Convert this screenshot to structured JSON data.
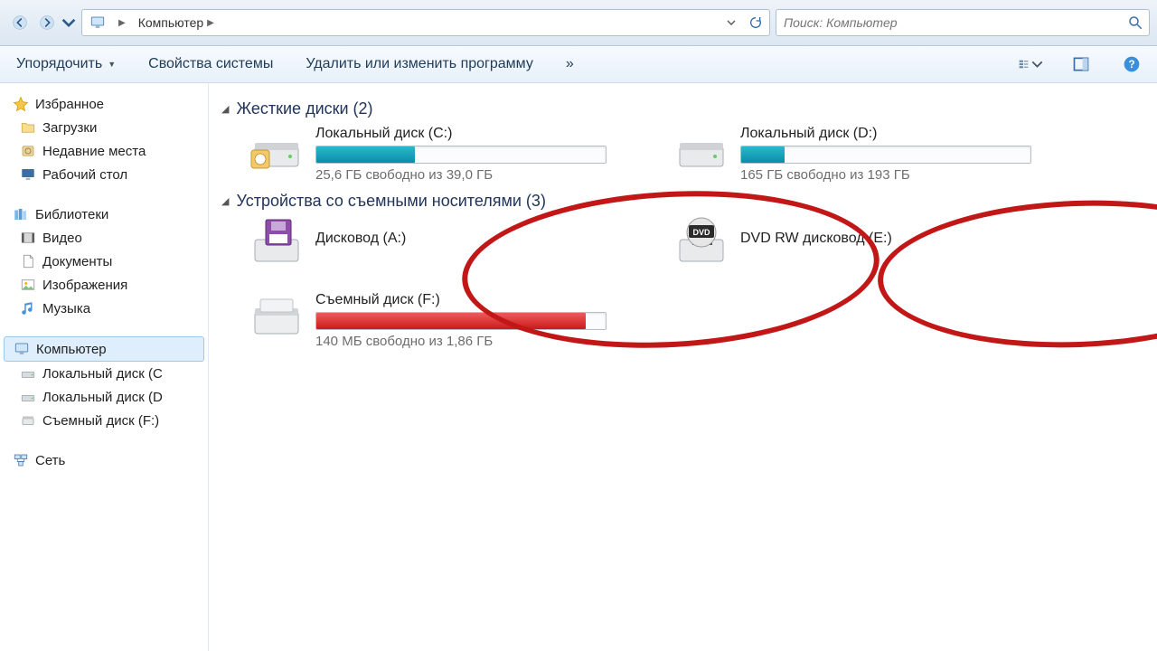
{
  "path": {
    "location_label": "Компьютер"
  },
  "search": {
    "placeholder": "Поиск: Компьютер"
  },
  "toolbar": {
    "organize": "Упорядочить",
    "sys_props": "Свойства системы",
    "uninstall": "Удалить или изменить программу",
    "overflow": "»"
  },
  "nav": {
    "favorites": "Избранное",
    "downloads": "Загрузки",
    "recent": "Недавние места",
    "desktop": "Рабочий стол",
    "libraries": "Библиотеки",
    "video": "Видео",
    "documents": "Документы",
    "pictures": "Изображения",
    "music": "Музыка",
    "computer": "Компьютер",
    "disk_c": "Локальный диск  (C",
    "disk_d": "Локальный диск (D",
    "disk_f": "Съемный диск (F:)",
    "network": "Сеть"
  },
  "sections": {
    "hdd": "Жесткие диски (2)",
    "removable": "Устройства со съемными носителями (3)"
  },
  "drives": {
    "c": {
      "title": "Локальный диск  (C:)",
      "sub": "25,6 ГБ свободно из 39,0 ГБ",
      "fill_pct": 34
    },
    "d": {
      "title": "Локальный диск (D:)",
      "sub": "165 ГБ свободно из 193 ГБ",
      "fill_pct": 15
    },
    "a": {
      "title": "Дисковод (A:)"
    },
    "e": {
      "title": "DVD RW дисковод (E:)"
    },
    "f": {
      "title": "Съемный диск (F:)",
      "sub": "140 МБ свободно из 1,86 ГБ",
      "fill_pct": 93
    }
  }
}
